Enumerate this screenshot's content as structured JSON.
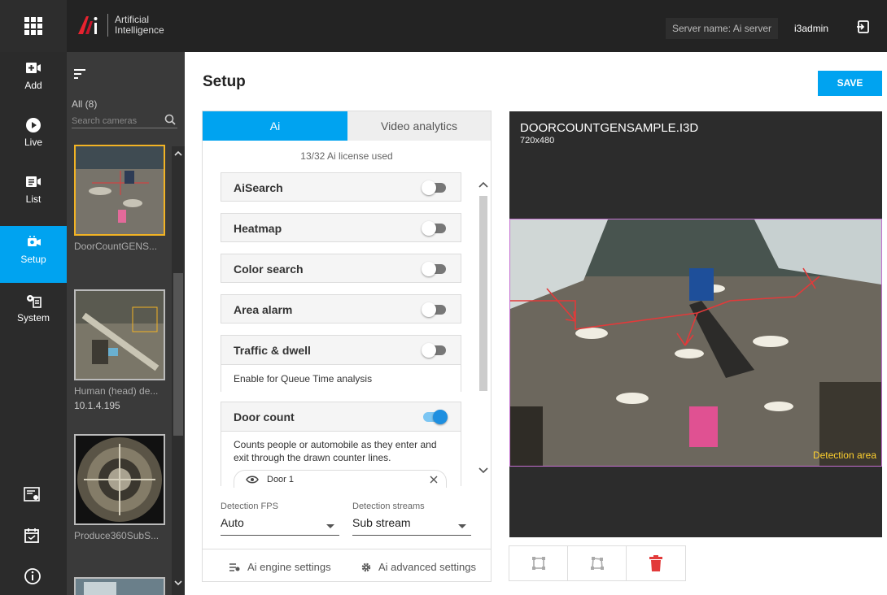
{
  "header": {
    "logo_line1": "Artificial",
    "logo_line2": "Intelligence",
    "server_name": "Server name: Ai server",
    "user": "i3admin",
    "icons": [
      "apps-grid-icon",
      "logout-icon"
    ]
  },
  "nav": {
    "items": [
      {
        "label": "Add",
        "icon": "add-camera-icon"
      },
      {
        "label": "Live",
        "icon": "play-icon"
      },
      {
        "label": "List",
        "icon": "list-icon"
      },
      {
        "label": "Setup",
        "icon": "camera-settings-icon",
        "active": true
      },
      {
        "label": "System",
        "icon": "system-icon"
      }
    ],
    "bottom_icons": [
      "license-icon",
      "calendar-icon",
      "info-icon"
    ]
  },
  "cameras": {
    "all_label": "All (8)",
    "search_placeholder": "Search cameras",
    "items": [
      {
        "name": "DoorCountGENS...",
        "selected": true
      },
      {
        "name": "Human (head) de...",
        "ip": "10.1.4.195"
      },
      {
        "name": "Produce360SubS..."
      }
    ]
  },
  "page": {
    "title": "Setup",
    "save_label": "SAVE"
  },
  "setup_panel": {
    "tabs": [
      "Ai",
      "Video analytics"
    ],
    "active_tab": "Ai",
    "license_text": "13/32 Ai license used",
    "features": [
      {
        "name": "AiSearch",
        "enabled": false
      },
      {
        "name": "Heatmap",
        "enabled": false
      },
      {
        "name": "Color search",
        "enabled": false
      },
      {
        "name": "Area alarm",
        "enabled": false
      },
      {
        "name": "Traffic & dwell",
        "enabled": false,
        "description": "Enable for Queue Time analysis"
      },
      {
        "name": "Door count",
        "enabled": true,
        "description": "Counts people or automobile as they enter and exit through the drawn counter lines."
      }
    ],
    "door_item": "Door 1",
    "fps_label": "Detection FPS",
    "fps_value": "Auto",
    "streams_label": "Detection streams",
    "streams_value": "Sub stream",
    "footer_engine": "Ai engine settings",
    "footer_advanced": "Ai advanced settings"
  },
  "video": {
    "title": "DOORCOUNTGENSAMPLE.I3D",
    "resolution": "720x480",
    "detection_label": "Detection area",
    "colors": {
      "region_border": "#c36fd0",
      "line": "#e23a3a",
      "label": "#ffd12e"
    }
  },
  "tools": [
    "rectangle-icon",
    "polygon-icon",
    "delete-icon"
  ],
  "colors": {
    "accent": "#00a3f0",
    "header_bg": "#232323",
    "nav_bg": "#2b2b2b",
    "danger": "#e23a3a"
  }
}
